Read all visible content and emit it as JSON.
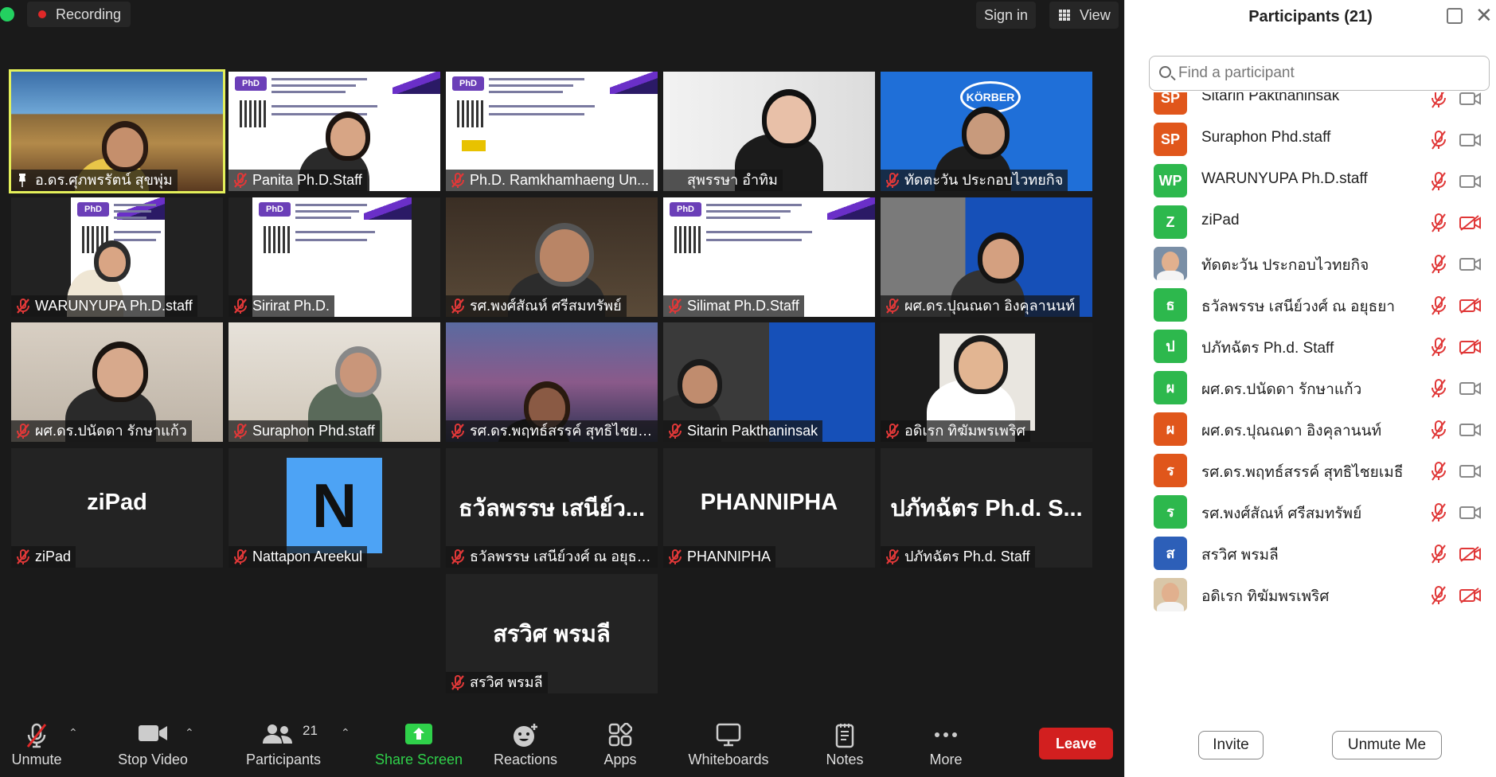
{
  "meeting": {
    "recording_label": "Recording",
    "sign_in_label": "Sign in",
    "view_label": "View",
    "tiles": [
      {
        "name": "อ.ดร.ศุภพรรัตน์ สุขพุ่ม",
        "active": true,
        "pinned": true,
        "muted": false
      },
      {
        "name": "Panita Ph.D.Staff",
        "muted": true
      },
      {
        "name": "Ph.D. Ramkhamhaeng Un...",
        "muted": true
      },
      {
        "name": "สุพรรษา อำทิม",
        "muted": false
      },
      {
        "name": "ทัดตะวัน ประกอบไวทยกิจ",
        "muted": true
      },
      {
        "name": "WARUNYUPA Ph.D.staff",
        "muted": true
      },
      {
        "name": "Sirirat Ph.D.",
        "muted": true
      },
      {
        "name": "รศ.พงศ์สัณห์  ศรีสมทรัพย์",
        "muted": true
      },
      {
        "name": "Silimat Ph.D.Staff",
        "muted": true
      },
      {
        "name": "ผศ.ดร.ปุณณดา  อิงคุลานนท์",
        "muted": true
      },
      {
        "name": "ผศ.ดร.ปนัดดา รักษาแก้ว",
        "muted": true
      },
      {
        "name": "Suraphon Phd.staff",
        "muted": true
      },
      {
        "name": "รศ.ดร.พฤทธ์สรรค์ สุทธิไชยเมธี",
        "muted": true
      },
      {
        "name": "Sitarin Pakthaninsak",
        "muted": true
      },
      {
        "name": "อดิเรก ทิฆัมพรเพริศ",
        "muted": true
      },
      {
        "name": "ziPad",
        "muted": true,
        "display": "ziPad"
      },
      {
        "name": "Nattapon Areekul",
        "muted": true,
        "avatar_letter": "N"
      },
      {
        "name": "ธวัลพรรษ เสนีย์วงศ์ ณ อยุธยา",
        "muted": true,
        "display": "ธวัลพรรษ เสนีย์ว..."
      },
      {
        "name": "PHANNIPHA",
        "muted": true,
        "display": "PHANNIPHA"
      },
      {
        "name": "ปภัทฉัตร Ph.d. Staff",
        "muted": true,
        "display": "ปภัทฉัตร Ph.d. S..."
      },
      {
        "name": "สรวิศ พรมลี",
        "muted": true,
        "display": "สรวิศ พรมลี"
      }
    ]
  },
  "toolbar": {
    "unmute": "Unmute",
    "stop_video": "Stop Video",
    "participants": "Participants",
    "participants_count": "21",
    "share_screen": "Share Screen",
    "reactions": "Reactions",
    "apps": "Apps",
    "whiteboards": "Whiteboards",
    "notes": "Notes",
    "more": "More",
    "leave": "Leave"
  },
  "panel": {
    "title": "Participants (21)",
    "search_placeholder": "Find a participant",
    "invite": "Invite",
    "unmute_me": "Unmute Me",
    "participants": [
      {
        "initials": "SP",
        "name": "Sitarin Pakthaninsak",
        "color": "#e0561b",
        "video_off": false
      },
      {
        "initials": "SP",
        "name": "Suraphon Phd.staff",
        "color": "#e0561b",
        "video_off": false
      },
      {
        "initials": "WP",
        "name": "WARUNYUPA Ph.D.staff",
        "color": "#2db84d",
        "video_off": false
      },
      {
        "initials": "Z",
        "name": "ziPad",
        "color": "#2db84d",
        "video_off": true
      },
      {
        "initials": "",
        "name": "ทัดตะวัน ประกอบไวทยกิจ",
        "color": "#7a8fa6",
        "video_off": false,
        "photo": true
      },
      {
        "initials": "ธ",
        "name": "ธวัลพรรษ เสนีย์วงศ์ ณ อยุธยา",
        "color": "#2db84d",
        "video_off": true
      },
      {
        "initials": "ป",
        "name": "ปภัทฉัตร Ph.d. Staff",
        "color": "#2db84d",
        "video_off": true
      },
      {
        "initials": "ผ",
        "name": "ผศ.ดร.ปนัดดา รักษาแก้ว",
        "color": "#2db84d",
        "video_off": false
      },
      {
        "initials": "ผ",
        "name": "ผศ.ดร.ปุณณดา  อิงคุลานนท์",
        "color": "#e0561b",
        "video_off": false
      },
      {
        "initials": "ร",
        "name": "รศ.ดร.พฤทธ์สรรค์ สุทธิไชยเมธี",
        "color": "#e0561b",
        "video_off": false
      },
      {
        "initials": "ร",
        "name": "รศ.พงศ์สัณห์  ศรีสมทรัพย์",
        "color": "#2db84d",
        "video_off": false
      },
      {
        "initials": "ส",
        "name": "สรวิศ พรมลี",
        "color": "#2d5fb8",
        "video_off": true
      },
      {
        "initials": "",
        "name": "อดิเรก ทิฆัมพรเพริศ",
        "color": "#d9c7a8",
        "video_off": true,
        "photo": true
      }
    ]
  }
}
